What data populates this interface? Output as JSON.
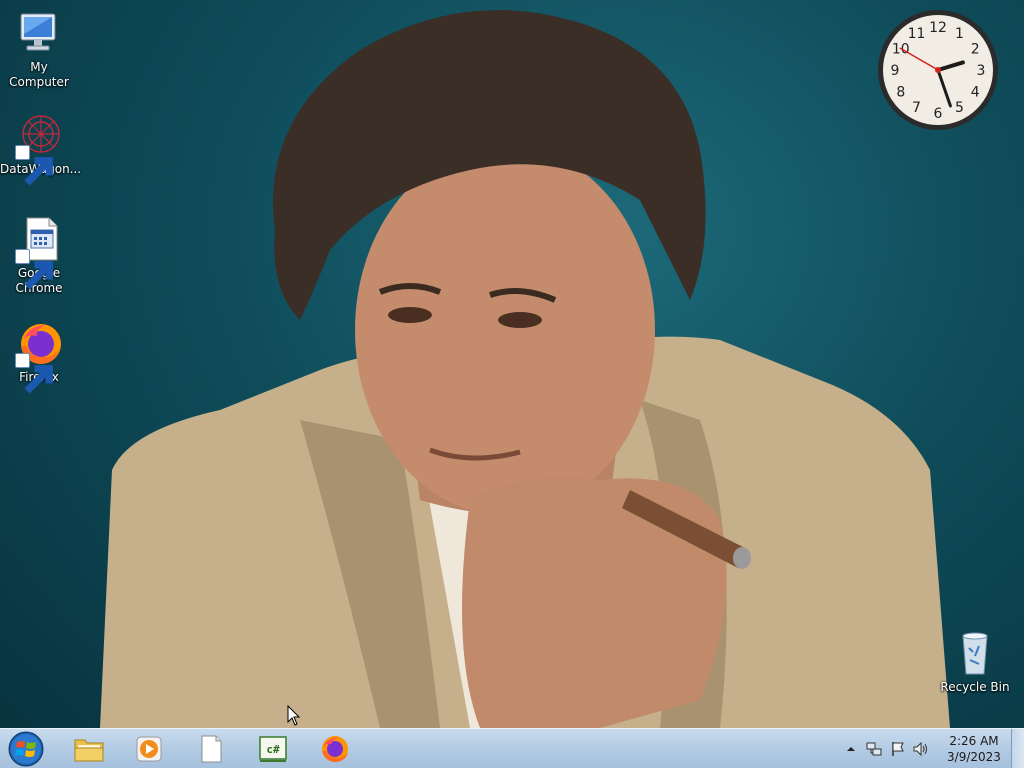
{
  "desktop": {
    "icons": [
      {
        "label": "My Computer",
        "icon": "computer-icon"
      },
      {
        "label": "DataWagon...",
        "icon": "datawagon-icon"
      },
      {
        "label": "Google Chrome",
        "icon": "chrome-shortcut-icon"
      },
      {
        "label": "Firefox",
        "icon": "firefox-icon"
      },
      {
        "label": "Recycle Bin",
        "icon": "recycle-bin-icon"
      }
    ],
    "clock_gadget": {
      "hour": 2,
      "minute": 26,
      "second": 50
    }
  },
  "taskbar": {
    "start_icon": "windows-start-icon",
    "pinned": [
      {
        "name": "file-explorer",
        "icon": "folder-icon"
      },
      {
        "name": "media-player",
        "icon": "media-player-icon"
      },
      {
        "name": "blank-document",
        "icon": "document-icon"
      },
      {
        "name": "csharp-editor",
        "icon": "csharp-icon"
      },
      {
        "name": "firefox",
        "icon": "firefox-icon"
      }
    ],
    "tray": {
      "icons": [
        "show-hidden-icons-chevron",
        "network-icon",
        "action-center-flag-icon",
        "volume-icon"
      ],
      "time": "2:26 AM",
      "date": "3/9/2023"
    }
  },
  "colors": {
    "wallpaper_bg": "#0f4c5a",
    "taskbar": "#b3cbe3",
    "clock_second_hand": "#d62020"
  }
}
